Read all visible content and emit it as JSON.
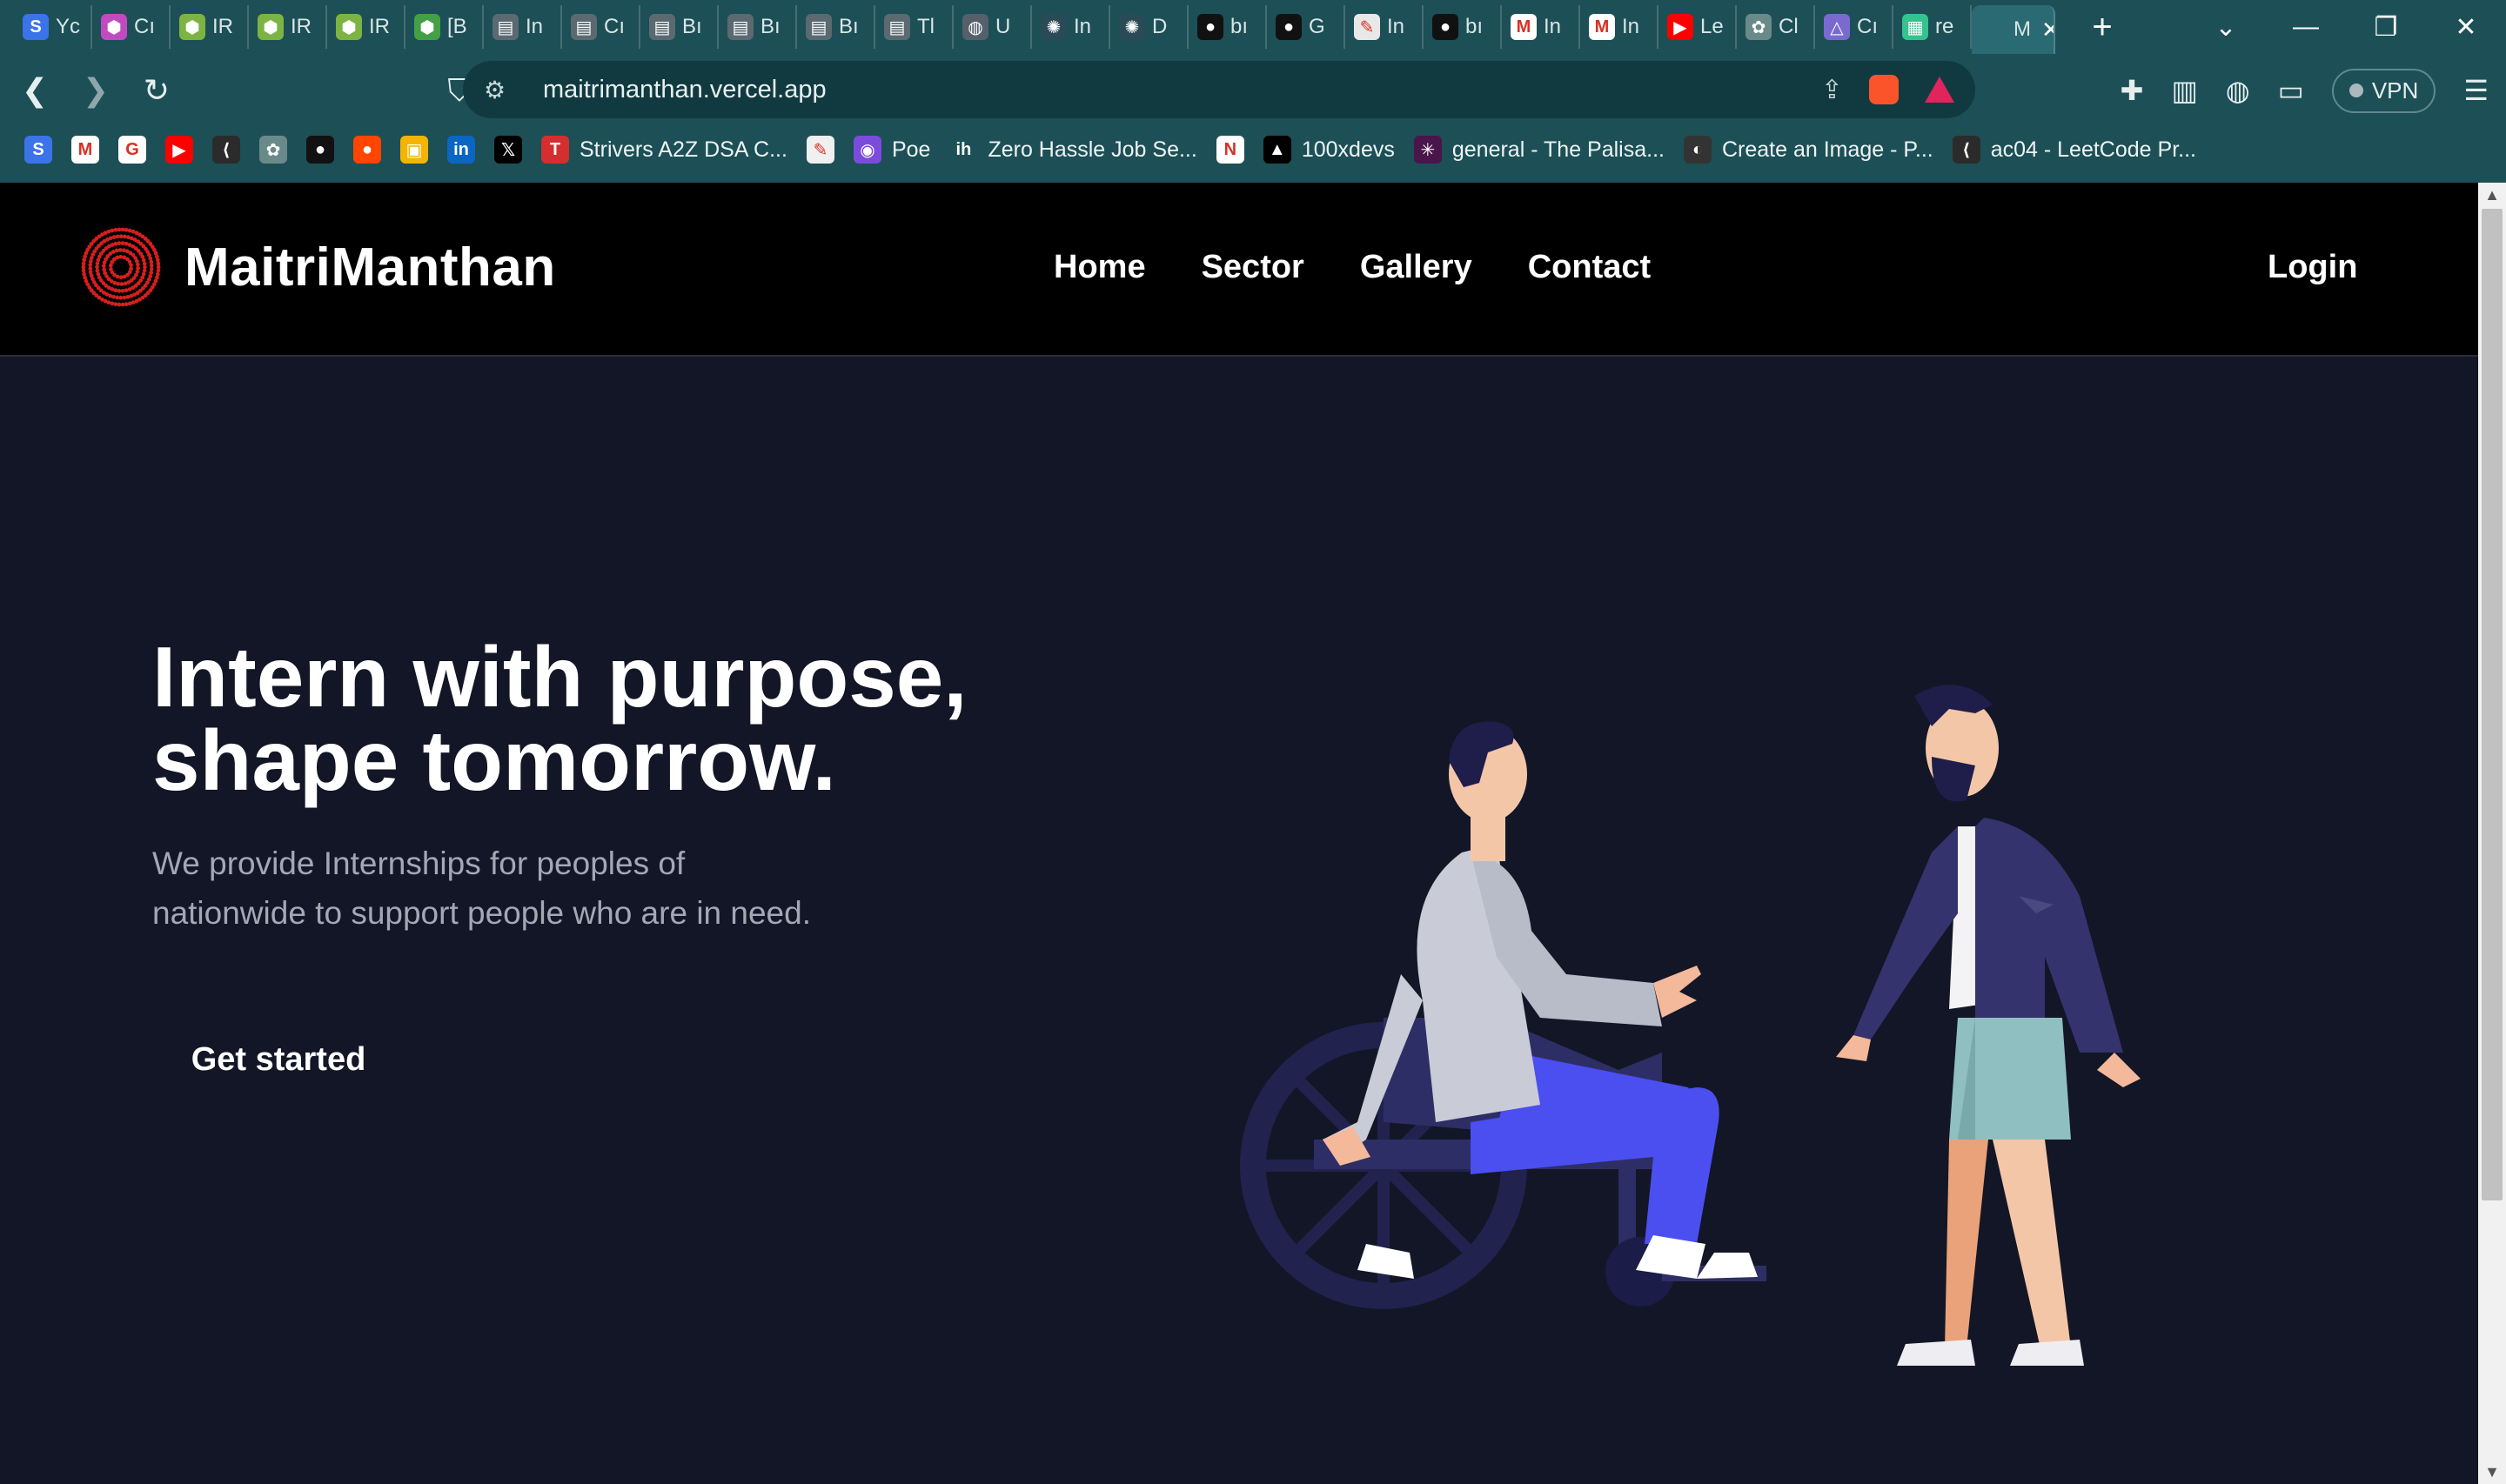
{
  "browser": {
    "tabs": [
      {
        "label": "Yc",
        "icon": "s-icon",
        "color": "#3b73e8",
        "glyph": "S"
      },
      {
        "label": "Cı",
        "icon": "hexagon-icon",
        "color": "#c04ac0",
        "glyph": "⬢"
      },
      {
        "label": "IR",
        "icon": "hexagon-icon",
        "color": "#7cb342",
        "glyph": "⬢"
      },
      {
        "label": "IR",
        "icon": "hexagon-icon",
        "color": "#7cb342",
        "glyph": "⬢"
      },
      {
        "label": "IR",
        "icon": "hexagon-icon",
        "color": "#7cb342",
        "glyph": "⬢"
      },
      {
        "label": "[B",
        "icon": "hexagon-icon",
        "color": "#43a047",
        "glyph": "⬢"
      },
      {
        "label": "In",
        "icon": "book-icon",
        "color": "#5a6a70",
        "glyph": "▤"
      },
      {
        "label": "Cı",
        "icon": "book-icon",
        "color": "#5a6a70",
        "glyph": "▤"
      },
      {
        "label": "Bı",
        "icon": "book-icon",
        "color": "#5a6a70",
        "glyph": "▤"
      },
      {
        "label": "Bı",
        "icon": "book-icon",
        "color": "#5a6a70",
        "glyph": "▤"
      },
      {
        "label": "Bı",
        "icon": "book-icon",
        "color": "#5a6a70",
        "glyph": "▤"
      },
      {
        "label": "Tl",
        "icon": "book-icon",
        "color": "#5a6a70",
        "glyph": "▤"
      },
      {
        "label": "U",
        "icon": "globe-icon",
        "color": "#55606a",
        "glyph": "◍"
      },
      {
        "label": "In",
        "icon": "react-icon",
        "color": "#2a4a55",
        "glyph": "✺"
      },
      {
        "label": "D",
        "icon": "react-icon",
        "color": "#2a4a55",
        "glyph": "✺"
      },
      {
        "label": "bı",
        "icon": "github-icon",
        "color": "#111111",
        "glyph": "●"
      },
      {
        "label": "G",
        "icon": "github-icon",
        "color": "#111111",
        "glyph": "●"
      },
      {
        "label": "In",
        "icon": "pencil-icon",
        "color": "#e8e8e8",
        "glyph": "✎"
      },
      {
        "label": "bı",
        "icon": "github-icon",
        "color": "#111111",
        "glyph": "●"
      },
      {
        "label": "In",
        "icon": "gmail-icon",
        "color": "#ffffff",
        "glyph": "M"
      },
      {
        "label": "In",
        "icon": "gmail-icon",
        "color": "#ffffff",
        "glyph": "M"
      },
      {
        "label": "Le",
        "icon": "youtube-icon",
        "color": "#ff0000",
        "glyph": "▶"
      },
      {
        "label": "Cl",
        "icon": "chatgpt-icon",
        "color": "#6a8a8a",
        "glyph": "✿"
      },
      {
        "label": "Cı",
        "icon": "triangle-logo-icon",
        "color": "#7a6ad0",
        "glyph": "△"
      },
      {
        "label": "re",
        "icon": "grid-icon",
        "color": "#34c38f",
        "glyph": "▦"
      },
      {
        "label": "M",
        "icon": "m-icon",
        "color": "#2a6a72",
        "glyph": "",
        "active": true
      }
    ],
    "url": "maitrimanthan.vercel.app",
    "vpn_label": "VPN",
    "bookmarks": [
      {
        "label": "",
        "icon": "s-icon",
        "color": "#3b73e8",
        "glyph": "S"
      },
      {
        "label": "",
        "icon": "gmail-icon",
        "color": "#ffffff",
        "glyph": "M"
      },
      {
        "label": "",
        "icon": "google-icon",
        "color": "#ffffff",
        "glyph": "G"
      },
      {
        "label": "",
        "icon": "youtube-icon",
        "color": "#ff0000",
        "glyph": "▶"
      },
      {
        "label": "",
        "icon": "leetcode-icon",
        "color": "#2b2b2b",
        "glyph": "⟨"
      },
      {
        "label": "",
        "icon": "chatgpt-icon",
        "color": "#6a8a8a",
        "glyph": "✿"
      },
      {
        "label": "",
        "icon": "github-icon",
        "color": "#111111",
        "glyph": "●"
      },
      {
        "label": "",
        "icon": "reddit-icon",
        "color": "#ff4500",
        "glyph": "●"
      },
      {
        "label": "",
        "icon": "classroom-icon",
        "color": "#f4b400",
        "glyph": "▣"
      },
      {
        "label": "",
        "icon": "linkedin-icon",
        "color": "#0a66c2",
        "glyph": "in"
      },
      {
        "label": "",
        "icon": "x-icon",
        "color": "#000000",
        "glyph": "𝕏"
      },
      {
        "label": "Strivers A2Z DSA C...",
        "icon": "tuf-icon",
        "color": "#d32f2f",
        "glyph": "T"
      },
      {
        "label": "",
        "icon": "notepad-icon",
        "color": "#f0f0f0",
        "glyph": "✎"
      },
      {
        "label": "Poe",
        "icon": "poe-icon",
        "color": "#7b4bdc",
        "glyph": "◉"
      },
      {
        "label": "Zero Hassle Job Se...",
        "icon": "ih-icon",
        "color": "#1d4f56",
        "glyph": "ih"
      },
      {
        "label": "",
        "icon": "notion-icon",
        "color": "#ffffff",
        "glyph": "N"
      },
      {
        "label": "100xdevs",
        "icon": "triangle-icon",
        "color": "#000000",
        "glyph": "▲"
      },
      {
        "label": "general - The Palisa...",
        "icon": "slack-icon",
        "color": "#4a154b",
        "glyph": "✳"
      },
      {
        "label": "Create an Image - P...",
        "icon": "circle-icon",
        "color": "#333333",
        "glyph": "◐"
      },
      {
        "label": "ac04 - LeetCode Pr...",
        "icon": "leetcode-icon",
        "color": "#2b2b2b",
        "glyph": "⟨"
      }
    ]
  },
  "site": {
    "brand": "MaitriManthan",
    "menu": [
      "Home",
      "Sector",
      "Gallery",
      "Contact"
    ],
    "login": "Login",
    "hero_title_lines": [
      "Intern with purpose,",
      "shape tomorrow."
    ],
    "hero_sub_lines": [
      "We provide Internships for peoples of",
      "nationwide to support people who are in need."
    ],
    "cta": "Get started"
  },
  "colors": {
    "chrome": "#1d4f56",
    "page_bg": "#131626",
    "nav_bg": "#000000",
    "logo_accent": "#d81e1e",
    "wheelchair": "#2a2a5c",
    "pants_blue": "#4b4ff0",
    "jacket_navy": "#34336e"
  }
}
